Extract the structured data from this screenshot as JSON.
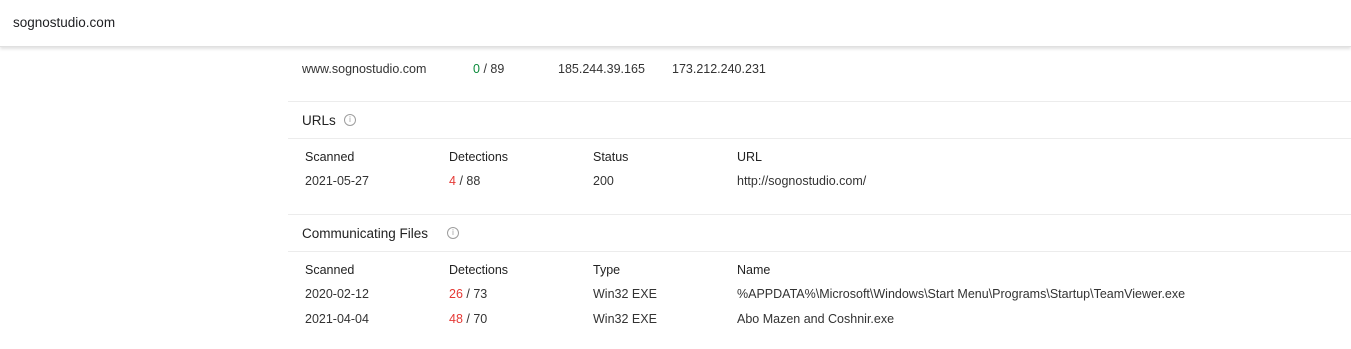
{
  "header": {
    "domain": "sognostudio.com"
  },
  "resolution": {
    "host": "www.sognostudio.com",
    "detections_positive": "0",
    "detections_total": "/ 89",
    "ip_1": "185.244.39.165",
    "ip_2": "173.212.240.231"
  },
  "urls": {
    "title": "URLs",
    "columns": [
      "Scanned",
      "Detections",
      "Status",
      "URL"
    ],
    "rows": [
      {
        "scanned": "2021-05-27",
        "detections_positive": "4",
        "detections_total": "/ 88",
        "status": "200",
        "url": "http://sognostudio.com/"
      }
    ]
  },
  "communicating_files": {
    "title": "Communicating Files",
    "columns": [
      "Scanned",
      "Detections",
      "Type",
      "Name"
    ],
    "rows": [
      {
        "scanned": "2020-02-12",
        "detections_positive": "26",
        "detections_total": "/ 73",
        "type": "Win32 EXE",
        "name": "%APPDATA%\\Microsoft\\Windows\\Start Menu\\Programs\\Startup\\TeamViewer.exe"
      },
      {
        "scanned": "2021-04-04",
        "detections_positive": "48",
        "detections_total": "/ 70",
        "type": "Win32 EXE",
        "name": "Abo Mazen and Coshnir.exe"
      }
    ]
  },
  "icons": {
    "info": "info-icon"
  },
  "colors": {
    "clean": "#0b8a3a",
    "malicious": "#e53935"
  }
}
